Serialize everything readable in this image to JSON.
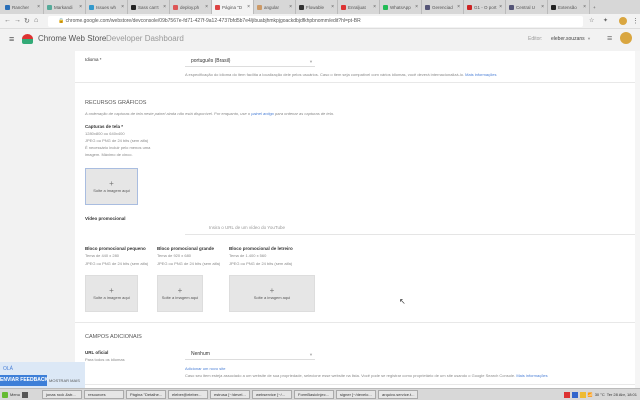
{
  "browser": {
    "tabs": [
      {
        "label": "Rancher",
        "color": "#2a6fb8"
      },
      {
        "label": "Markandi",
        "color": "#5a9"
      },
      {
        "label": "Issues wh",
        "color": "#39c"
      },
      {
        "label": "Sass can't",
        "color": "#222"
      },
      {
        "label": "deploy.ph",
        "color": "#d55"
      },
      {
        "label": "Página \"D",
        "color": "#d44"
      },
      {
        "label": "angular",
        "color": "#c96"
      },
      {
        "label": "Flowable",
        "color": "#333"
      },
      {
        "label": "Enraljuat",
        "color": "#d33"
      },
      {
        "label": "WhatsApp",
        "color": "#2b5"
      },
      {
        "label": "Gerenciad",
        "color": "#557"
      },
      {
        "label": "G1 - O port",
        "color": "#c22"
      },
      {
        "label": "Central U",
        "color": "#557"
      },
      {
        "label": "Extensão",
        "color": "#222"
      }
    ],
    "active_tab": 5,
    "url": "chrome.google.com/webstore/devconsole/09b7567e-fd71-427f-9a12-4737bfd5b7e4/jibuabjhmkpjgoackdbjdfkhpbnomm/edit?hl=pt-BR"
  },
  "header": {
    "title_strong": "Chrome Web Store",
    "title_light": "Developer Dashboard",
    "editor_label": "Editor:",
    "editor_value": "eleber.souzans"
  },
  "language": {
    "label": "Idioma *",
    "value": "português (Brasil)",
    "help": "A especificação do idioma do item facilita a localização dele pelos usuários. Caso o item seja compatível com vários idiomas, você deverá internacionalizá-lo.",
    "help_link": "Mais informações"
  },
  "graphics": {
    "section_title": "RECURSOS GRÁFICOS",
    "note_before": "A ordenação de capturas de tela neste painel ainda não está disponível. Por enquanto, use o",
    "note_link": "painel antigo",
    "note_after": "para ordenar as capturas de tela.",
    "screenshots": {
      "label": "Capturas de tela *",
      "lines": [
        "1280x800 ou 640x400",
        "JPEG ou PNG de 24 bits (sem alfa)",
        "É necessário incluir pelo menos uma",
        "imagem. Máximo de cinco."
      ],
      "drop_text": "Solte a imagem aqui"
    },
    "video": {
      "label": "Vídeo promocional",
      "placeholder": "Insira o URL de um vídeo do YouTube"
    },
    "tiles": [
      {
        "label": "Bloco promocional pequeno",
        "size": "Tema de 440 x 280",
        "format": "JPEG ou PNG de 24 bits (sem alfa)",
        "drop_text": "Solte a imagem aqui"
      },
      {
        "label": "Bloco promocional grande",
        "size": "Tema de 920 x 680",
        "format": "JPEG ou PNG de 24 bits (sem alfa)",
        "drop_text": "Solte a imagem aqui"
      },
      {
        "label": "Bloco promocional de letreiro",
        "size": "Tema de 1.400 x 560",
        "format": "JPEG ou PNG de 24 bits (sem alfa)",
        "drop_text": "Solte a imagem aqui"
      }
    ]
  },
  "additional": {
    "section_title": "CAMPOS ADICIONAIS",
    "url_label": "URL oficial",
    "url_sub": "Para todos os idiomas",
    "url_value": "Nenhum",
    "add_site": "Adicionar um novo site",
    "help": "Caso seu item esteja associado a um website de sua propriedade, selecione esse website na lista. Você pode se registrar como proprietário de um site usando o Google Search Console.",
    "help_link": "Mais informações"
  },
  "feedback": {
    "greeting": "OLÁ",
    "send": "ENVIAR FEEDBACK",
    "more": "MOSTRAR MAIS"
  },
  "taskbar": {
    "menu": "Menu",
    "items": [
      "jonas rock &str...",
      "resources",
      "Página \"Detalhe...",
      "eleber@eleber...",
      "estrusa [~/devel...",
      "webservice [~/...",
      "FormBasicInjec...",
      "signer [~/develo...",
      "arquivo.service.t..."
    ],
    "clock": "Ter 28 Abr, 18:01",
    "temp": "30 °C"
  }
}
